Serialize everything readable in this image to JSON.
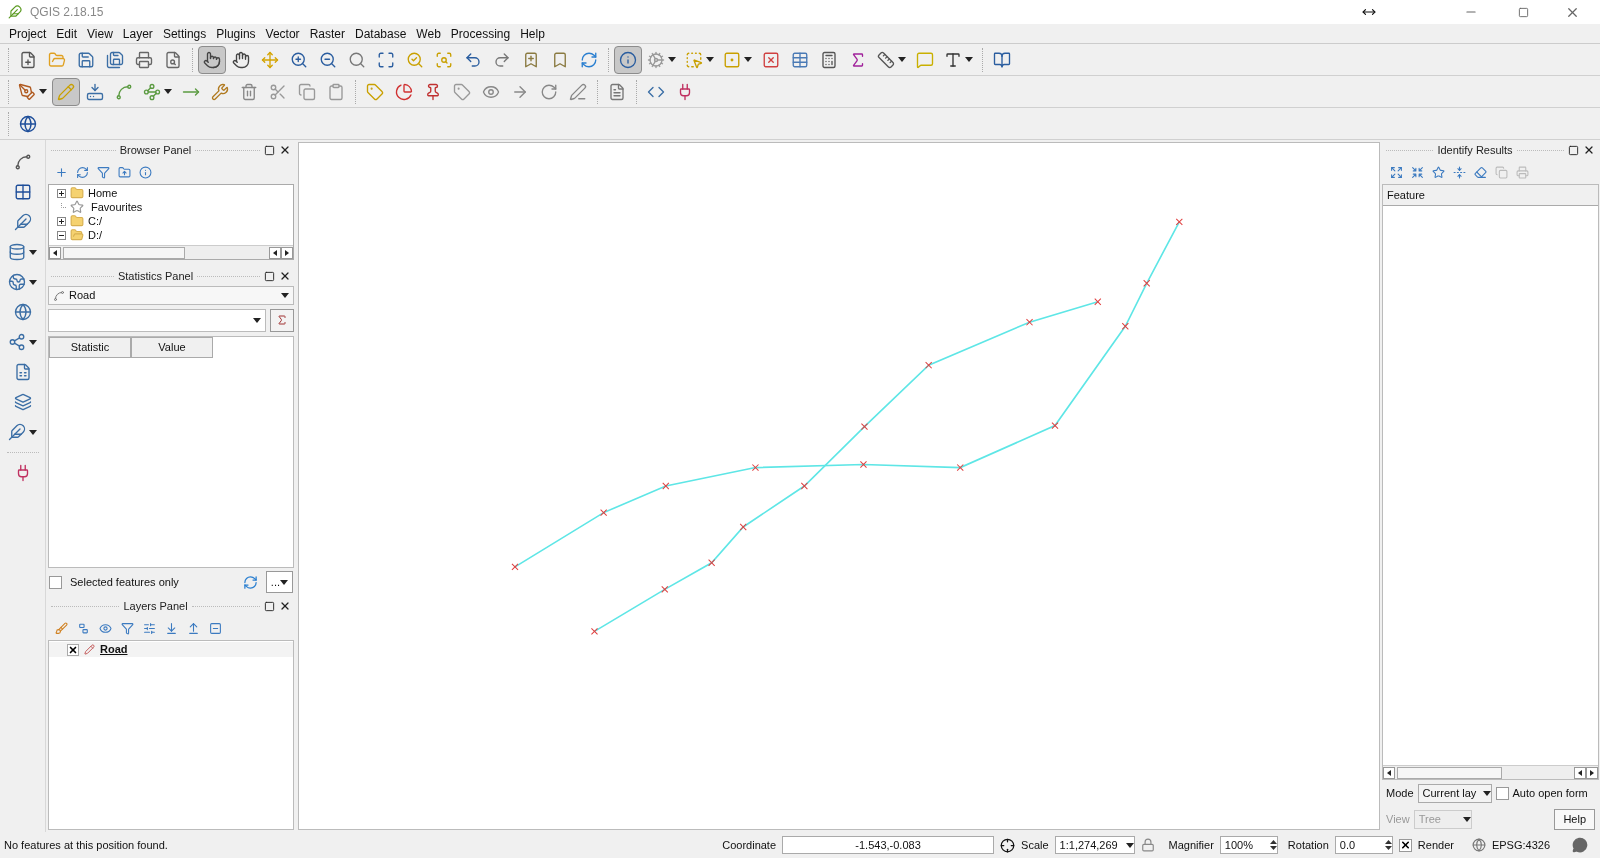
{
  "window": {
    "title": "QGIS 2.18.15"
  },
  "menu": [
    "Project",
    "Edit",
    "View",
    "Layer",
    "Settings",
    "Plugins",
    "Vector",
    "Raster",
    "Database",
    "Web",
    "Processing",
    "Help"
  ],
  "toolbars": [
    [
      {
        "kind": "new-file",
        "selected": false,
        "dropdown": false
      },
      {
        "kind": "open",
        "selected": false,
        "dropdown": false
      },
      {
        "kind": "save",
        "selected": false,
        "dropdown": false
      },
      {
        "kind": "save-as",
        "selected": false,
        "dropdown": false
      },
      {
        "kind": "print",
        "selected": false,
        "dropdown": false
      },
      {
        "kind": "composer",
        "selected": false,
        "dropdown": false
      },
      {
        "kind": "sep"
      },
      {
        "kind": "touch",
        "selected": true,
        "dropdown": false
      },
      {
        "kind": "pan",
        "selected": false,
        "dropdown": false
      },
      {
        "kind": "pan-selection",
        "selected": false,
        "dropdown": false
      },
      {
        "kind": "zoom-in",
        "selected": false,
        "dropdown": false
      },
      {
        "kind": "zoom-out",
        "selected": false,
        "dropdown": false
      },
      {
        "kind": "zoom-native",
        "selected": false,
        "dropdown": false
      },
      {
        "kind": "zoom-full",
        "selected": false,
        "dropdown": false
      },
      {
        "kind": "zoom-selection",
        "selected": false,
        "dropdown": false
      },
      {
        "kind": "zoom-layer",
        "selected": false,
        "dropdown": false
      },
      {
        "kind": "zoom-last",
        "selected": false,
        "dropdown": false
      },
      {
        "kind": "zoom-next",
        "selected": false,
        "dropdown": false
      },
      {
        "kind": "bookmark-new",
        "selected": false,
        "dropdown": false
      },
      {
        "kind": "bookmark",
        "selected": false,
        "dropdown": false
      },
      {
        "kind": "refresh",
        "selected": false,
        "dropdown": false
      },
      {
        "kind": "sep"
      },
      {
        "kind": "identify",
        "selected": true,
        "dropdown": false
      },
      {
        "kind": "action",
        "selected": false,
        "dropdown": true
      },
      {
        "kind": "select",
        "selected": false,
        "dropdown": true
      },
      {
        "kind": "select-expression",
        "selected": false,
        "dropdown": true
      },
      {
        "kind": "deselect",
        "selected": false,
        "dropdown": false
      },
      {
        "kind": "table",
        "selected": false,
        "dropdown": false
      },
      {
        "kind": "calculator",
        "selected": false,
        "dropdown": false
      },
      {
        "kind": "sum",
        "selected": false,
        "dropdown": false
      },
      {
        "kind": "measure",
        "selected": false,
        "dropdown": true
      },
      {
        "kind": "tip",
        "selected": false,
        "dropdown": false
      },
      {
        "kind": "text",
        "selected": false,
        "dropdown": true
      },
      {
        "kind": "sep"
      },
      {
        "kind": "help",
        "selected": false,
        "dropdown": false
      }
    ],
    [
      {
        "kind": "edits",
        "selected": false,
        "dropdown": true
      },
      {
        "kind": "edit",
        "selected": true,
        "dropdown": false
      },
      {
        "kind": "save-edits",
        "selected": false,
        "dropdown": false
      },
      {
        "kind": "add-feature",
        "selected": false,
        "dropdown": false
      },
      {
        "kind": "add-line",
        "selected": false,
        "dropdown": true
      },
      {
        "kind": "move-feature",
        "selected": false,
        "dropdown": false
      },
      {
        "kind": "node-tool",
        "selected": false,
        "dropdown": false
      },
      {
        "kind": "delete",
        "selected": false,
        "dropdown": false
      },
      {
        "kind": "cut",
        "selected": false,
        "dropdown": false
      },
      {
        "kind": "copy",
        "selected": false,
        "dropdown": false
      },
      {
        "kind": "paste",
        "selected": false,
        "dropdown": false
      },
      {
        "kind": "sep"
      },
      {
        "kind": "label",
        "selected": false,
        "dropdown": false
      },
      {
        "kind": "diagram",
        "selected": false,
        "dropdown": false
      },
      {
        "kind": "label-pin",
        "selected": false,
        "dropdown": false
      },
      {
        "kind": "label-dim",
        "selected": false,
        "dropdown": false
      },
      {
        "kind": "label-eye",
        "selected": false,
        "dropdown": false
      },
      {
        "kind": "label-move",
        "selected": false,
        "dropdown": false
      },
      {
        "kind": "label-rotate",
        "selected": false,
        "dropdown": false
      },
      {
        "kind": "label-edit",
        "selected": false,
        "dropdown": false
      },
      {
        "kind": "sep"
      },
      {
        "kind": "csw",
        "selected": false,
        "dropdown": false
      },
      {
        "kind": "sep"
      },
      {
        "kind": "python",
        "selected": false,
        "dropdown": false
      },
      {
        "kind": "plugin",
        "selected": false,
        "dropdown": false
      }
    ],
    [
      {
        "kind": "globe",
        "selected": false,
        "dropdown": false
      }
    ]
  ],
  "side_tools": [
    {
      "kind": "add-vector",
      "dropdown": false
    },
    {
      "kind": "add-raster",
      "dropdown": false
    },
    {
      "kind": "add-spatialite",
      "dropdown": false
    },
    {
      "kind": "add-postgis",
      "dropdown": true
    },
    {
      "kind": "add-wms",
      "dropdown": true
    },
    {
      "kind": "add-wcs",
      "dropdown": false
    },
    {
      "kind": "add-wfs",
      "dropdown": true
    },
    {
      "kind": "add-delimited",
      "dropdown": false
    },
    {
      "kind": "add-virtual",
      "dropdown": false
    },
    {
      "kind": "new-layer",
      "dropdown": true
    },
    {
      "kind": "sep"
    },
    {
      "kind": "plugin",
      "dropdown": false
    }
  ],
  "browser_panel": {
    "title": "Browser Panel",
    "items": [
      {
        "label": "Home",
        "kind": "folder",
        "expandable": true,
        "expanded": false
      },
      {
        "label": "Favourites",
        "kind": "star",
        "expandable": false
      },
      {
        "label": "C:/",
        "kind": "folder",
        "expandable": true,
        "expanded": false
      },
      {
        "label": "D:/",
        "kind": "folder",
        "expandable": true,
        "expanded": true
      }
    ]
  },
  "statistics_panel": {
    "title": "Statistics Panel",
    "layer": "Road",
    "columns": [
      "Statistic",
      "Value"
    ],
    "selected_only": {
      "label": "Selected features only",
      "checked": false
    },
    "more_button": "..."
  },
  "layers_panel": {
    "title": "Layers Panel",
    "layers": [
      {
        "name": "Road",
        "visible": true,
        "editing": true
      }
    ]
  },
  "identify_panel": {
    "title": "Identify Results",
    "column": "Feature",
    "mode_label": "Mode",
    "mode": "Current lay",
    "auto_open": {
      "label": "Auto open form",
      "checked": false
    },
    "view_label": "View",
    "view": "Tree",
    "view_disabled": true,
    "help": "Help"
  },
  "status_bar": {
    "message": "No features at this position found.",
    "coordinate_label": "Coordinate",
    "coordinate": "-1.543,-0.083",
    "scale_label": "Scale",
    "scale": "1:1,274,269",
    "magnifier_label": "Magnifier",
    "magnifier": "100%",
    "rotation_label": "Rotation",
    "rotation": "0.0",
    "render": {
      "label": "Render",
      "checked": true
    },
    "crs": "EPSG:4326"
  }
}
